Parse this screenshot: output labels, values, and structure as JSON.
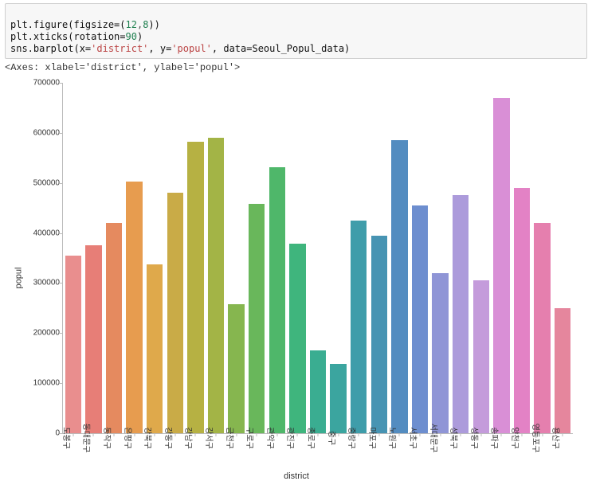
{
  "code_lines": {
    "l1a": "plt.figure(figsize=(",
    "l1b": "12",
    "l1c": ",",
    "l1d": "8",
    "l1e": "))",
    "l2a": "plt.xticks(rotation=",
    "l2b": "90",
    "l2c": ")",
    "l3a": "sns.barplot(x=",
    "l3b": "'district'",
    "l3c": ", y=",
    "l3d": "'popul'",
    "l3e": ", data=Seoul_Popul_data)"
  },
  "output_text": "<Axes: xlabel='district', ylabel='popul'>",
  "chart_data": {
    "type": "bar",
    "title": "",
    "xlabel": "district",
    "ylabel": "popul",
    "ylim": [
      0,
      700000
    ],
    "yticks": [
      0,
      100000,
      200000,
      300000,
      400000,
      500000,
      600000,
      700000
    ],
    "categories": [
      "도봉구",
      "동대문구",
      "동작구",
      "은평구",
      "강북구",
      "강동구",
      "강남구",
      "강서구",
      "금천구",
      "구로구",
      "관악구",
      "광진구",
      "종로구",
      "중구",
      "중랑구",
      "마포구",
      "노원구",
      "서초구",
      "서대문구",
      "성북구",
      "성동구",
      "송파구",
      "양천구",
      "영등포구",
      "용산구"
    ],
    "values": [
      355000,
      375000,
      420000,
      503000,
      338000,
      480000,
      582000,
      590000,
      258000,
      458000,
      532000,
      378000,
      165000,
      138000,
      425000,
      395000,
      585000,
      455000,
      320000,
      475000,
      305000,
      670000,
      490000,
      420000,
      250000
    ],
    "colors": [
      "#e98e8e",
      "#e77e77",
      "#e58a5f",
      "#e79c4f",
      "#dfa94b",
      "#c9ab47",
      "#b6b143",
      "#a3b446",
      "#86b64f",
      "#69b75b",
      "#4fb76a",
      "#3fb57d",
      "#3aad91",
      "#3ba59f",
      "#3f9daa",
      "#4794b3",
      "#538cc0",
      "#6d8ecf",
      "#8f95d6",
      "#ac9bdb",
      "#c49bdb",
      "#d98fd6",
      "#e382c5",
      "#e57fae",
      "#e5869d"
    ]
  }
}
